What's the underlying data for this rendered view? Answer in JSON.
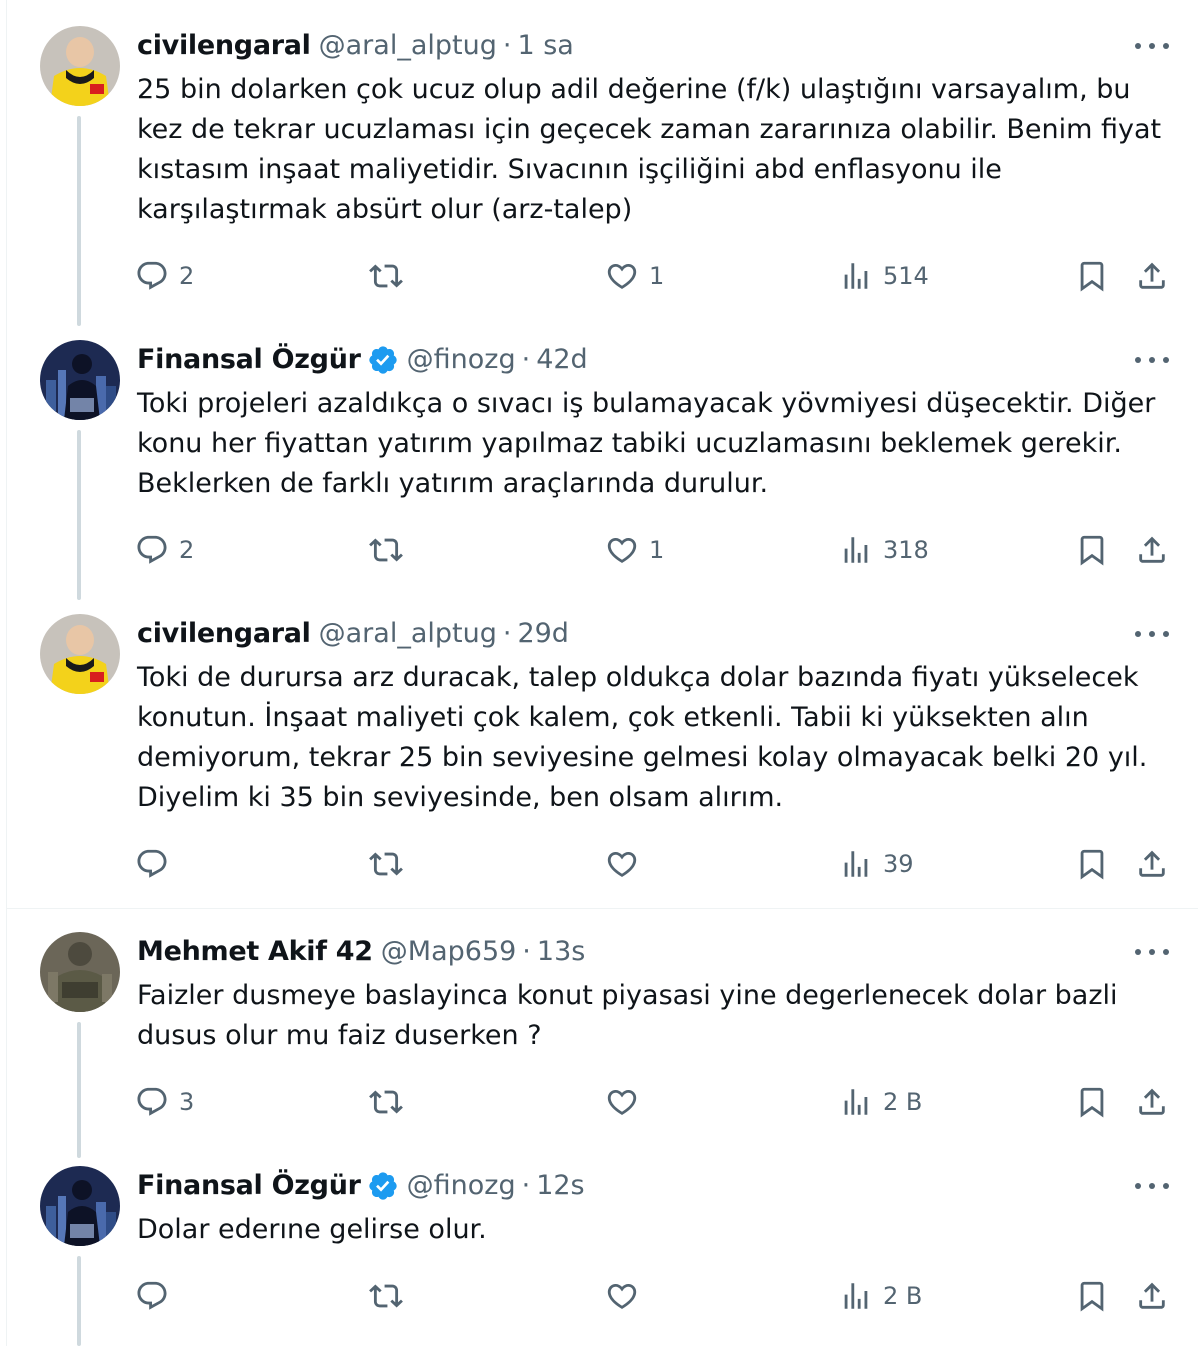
{
  "tweets": [
    {
      "name": "civilengaral",
      "handle": "@aral_alptug",
      "sep": "·",
      "time": "1 sa",
      "verified": false,
      "text": "25 bin dolarken çok ucuz olup adil değerine (f/k) ulaştığını varsayalım, bu\nkez de tekrar ucuzlaması için geçecek zaman zararınıza olabilir. Benim fiyat\nkıstasım inşaat maliyetidir. Sıvacının işçiliğini abd enflasyonu ile\nkarşılaştırmak absürt olur (arz-talep)",
      "replies": "2",
      "retweets": "",
      "likes": "1",
      "views": "514"
    },
    {
      "name": "Finansal Özgür",
      "handle": "@finozg",
      "sep": "·",
      "time": "42d",
      "verified": true,
      "text": "Toki projeleri azaldıkça o sıvacı iş bulamayacak yövmiyesi düşecektir. Diğer\nkonu her fiyattan yatırım yapılmaz tabiki ucuzlamasını beklemek gerekir.\nBeklerken de farklı yatırım araçlarında durulur.",
      "replies": "2",
      "retweets": "",
      "likes": "1",
      "views": "318"
    },
    {
      "name": "civilengaral",
      "handle": "@aral_alptug",
      "sep": "·",
      "time": "29d",
      "verified": false,
      "text": "Toki de durursa arz duracak, talep oldukça dolar bazında fiyatı yükselecek\nkonutun. İnşaat maliyeti çok kalem, çok etkenli. Tabii ki yüksekten alın\ndemiyorum, tekrar 25 bin seviyesine gelmesi kolay olmayacak belki 20 yıl.\nDiyelim ki 35 bin seviyesinde, ben olsam alırım.",
      "replies": "",
      "retweets": "",
      "likes": "",
      "views": "39"
    },
    {
      "name": "Mehmet Akif 42",
      "handle": "@Map659",
      "sep": "·",
      "time": "13s",
      "verified": false,
      "text": "Faizler dusmeye baslayinca konut piyasasi yine degerlenecek dolar bazli\ndusus olur mu faiz duserken ?",
      "replies": "3",
      "retweets": "",
      "likes": "",
      "views": "2 B"
    },
    {
      "name": "Finansal Özgür",
      "handle": "@finozg",
      "sep": "·",
      "time": "12s",
      "verified": true,
      "text": "Dolar ederıne gelirse olur.",
      "replies": "",
      "retweets": "",
      "likes": "",
      "views": "2 B"
    }
  ],
  "icons": {
    "reply": "reply-icon",
    "retweet": "retweet-icon",
    "like": "heart-icon",
    "views": "views-chart-icon",
    "bookmark": "bookmark-icon",
    "share": "share-icon",
    "more": "more-icon",
    "verified": "verified-badge-icon"
  },
  "colors": {
    "text": "#0f1419",
    "secondary": "#536471",
    "verified": "#1d9bf0",
    "thread_line": "#cfd9de"
  }
}
